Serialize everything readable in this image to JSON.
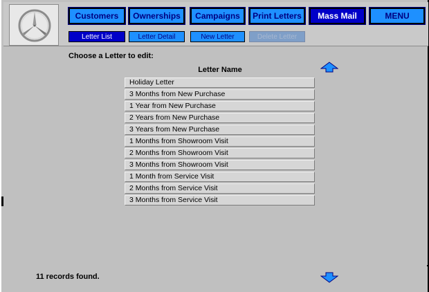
{
  "nav": {
    "customers": "Customers",
    "ownerships": "Ownerships",
    "campaigns": "Campaigns",
    "print_letters": "Print Letters",
    "mass_mail": "Mass Mail",
    "menu": "MENU"
  },
  "subnav": {
    "letter_list": "Letter List",
    "letter_detail": "Letter Detail",
    "new_letter": "New Letter",
    "delete_letter": "Delete Letter"
  },
  "main": {
    "prompt": "Choose a Letter to edit:",
    "column_header": "Letter Name",
    "letters": [
      "Holiday Letter",
      "3 Months from New Purchase",
      "1 Year from New Purchase",
      "2 Years from New Purchase",
      "3 Years from New Purchase",
      "1 Months from Showroom Visit",
      "2 Months from Showroom Visit",
      "3 Months from Showroom Visit",
      "1 Month from Service Visit",
      "2 Months from Service Visit",
      "3 Months from Service Visit"
    ],
    "status": "11 records found."
  },
  "icons": {
    "logo": "three-pointed-star-logo",
    "scroll_up": "up-arrow-icon",
    "scroll_down": "down-arrow-icon"
  },
  "colors": {
    "nav_button": "#1e90ff",
    "nav_active": "#0000c8",
    "background": "#c0c0c0"
  }
}
